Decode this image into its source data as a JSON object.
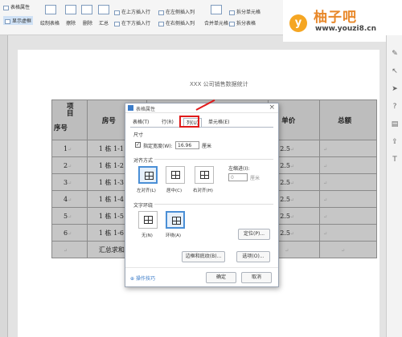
{
  "ribbon": {
    "items": [
      {
        "label": "表格属性"
      },
      {
        "label": "显示虚框"
      },
      {
        "label": "绘制表格"
      },
      {
        "label": "擦除"
      },
      {
        "label": "删除"
      },
      {
        "label": "汇总"
      },
      {
        "label": "在上方插入行"
      },
      {
        "label": "在下方插入行"
      },
      {
        "label": "在左侧插入列"
      },
      {
        "label": "在右侧插入列"
      },
      {
        "label": "合并单元格"
      },
      {
        "label": "拆分单元格"
      },
      {
        "label": "拆分表格"
      }
    ]
  },
  "watermark": {
    "logo_letter": "y",
    "title": "柚子吧",
    "url": "www.youzi8.cn"
  },
  "document": {
    "title": "XXX 公司销售数据统计",
    "table": {
      "header": {
        "diag_top": "项目",
        "diag_bottom": "序号",
        "col2": "房号",
        "col_price": "单价",
        "col_total": "总额"
      },
      "rows": [
        {
          "no": "1",
          "room": "1 栋 1-1",
          "price": "2.5"
        },
        {
          "no": "2",
          "room": "1 栋 1-2",
          "price": "2.5"
        },
        {
          "no": "3",
          "room": "1 栋 1-3",
          "price": "2.5"
        },
        {
          "no": "4",
          "room": "1 栋 1-4",
          "price": "2.5"
        },
        {
          "no": "5",
          "room": "1 栋 1-5",
          "price": "2.5"
        },
        {
          "no": "6",
          "room": "1 栋 1-6",
          "price": "2.5"
        }
      ],
      "sum_row_label": "汇总求和"
    }
  },
  "dialog": {
    "title": "表格属性",
    "close": "×",
    "tabs": [
      {
        "label": "表格(T)"
      },
      {
        "label": "行(R)"
      },
      {
        "label": "列(U)"
      },
      {
        "label": "单元格(E)"
      }
    ],
    "size_section": "尺寸",
    "preferred_width_label": "指定宽度(W):",
    "preferred_width_value": "16.96",
    "unit": "厘米",
    "align_section": "对齐方式",
    "indent_label": "左缩进(I):",
    "indent_value": "0",
    "align_options": [
      {
        "label": "左对齐(L)"
      },
      {
        "label": "居中(C)"
      },
      {
        "label": "右对齐(H)"
      }
    ],
    "wrap_section": "文字环绕",
    "wrap_options": [
      {
        "label": "无(N)"
      },
      {
        "label": "环绕(A)"
      }
    ],
    "position_button": "定位(P)...",
    "borders_button": "边框和底纹(B)...",
    "options_button": "选项(O)...",
    "tips_link": "操作技巧",
    "ok_button": "确定",
    "cancel_button": "取消"
  }
}
